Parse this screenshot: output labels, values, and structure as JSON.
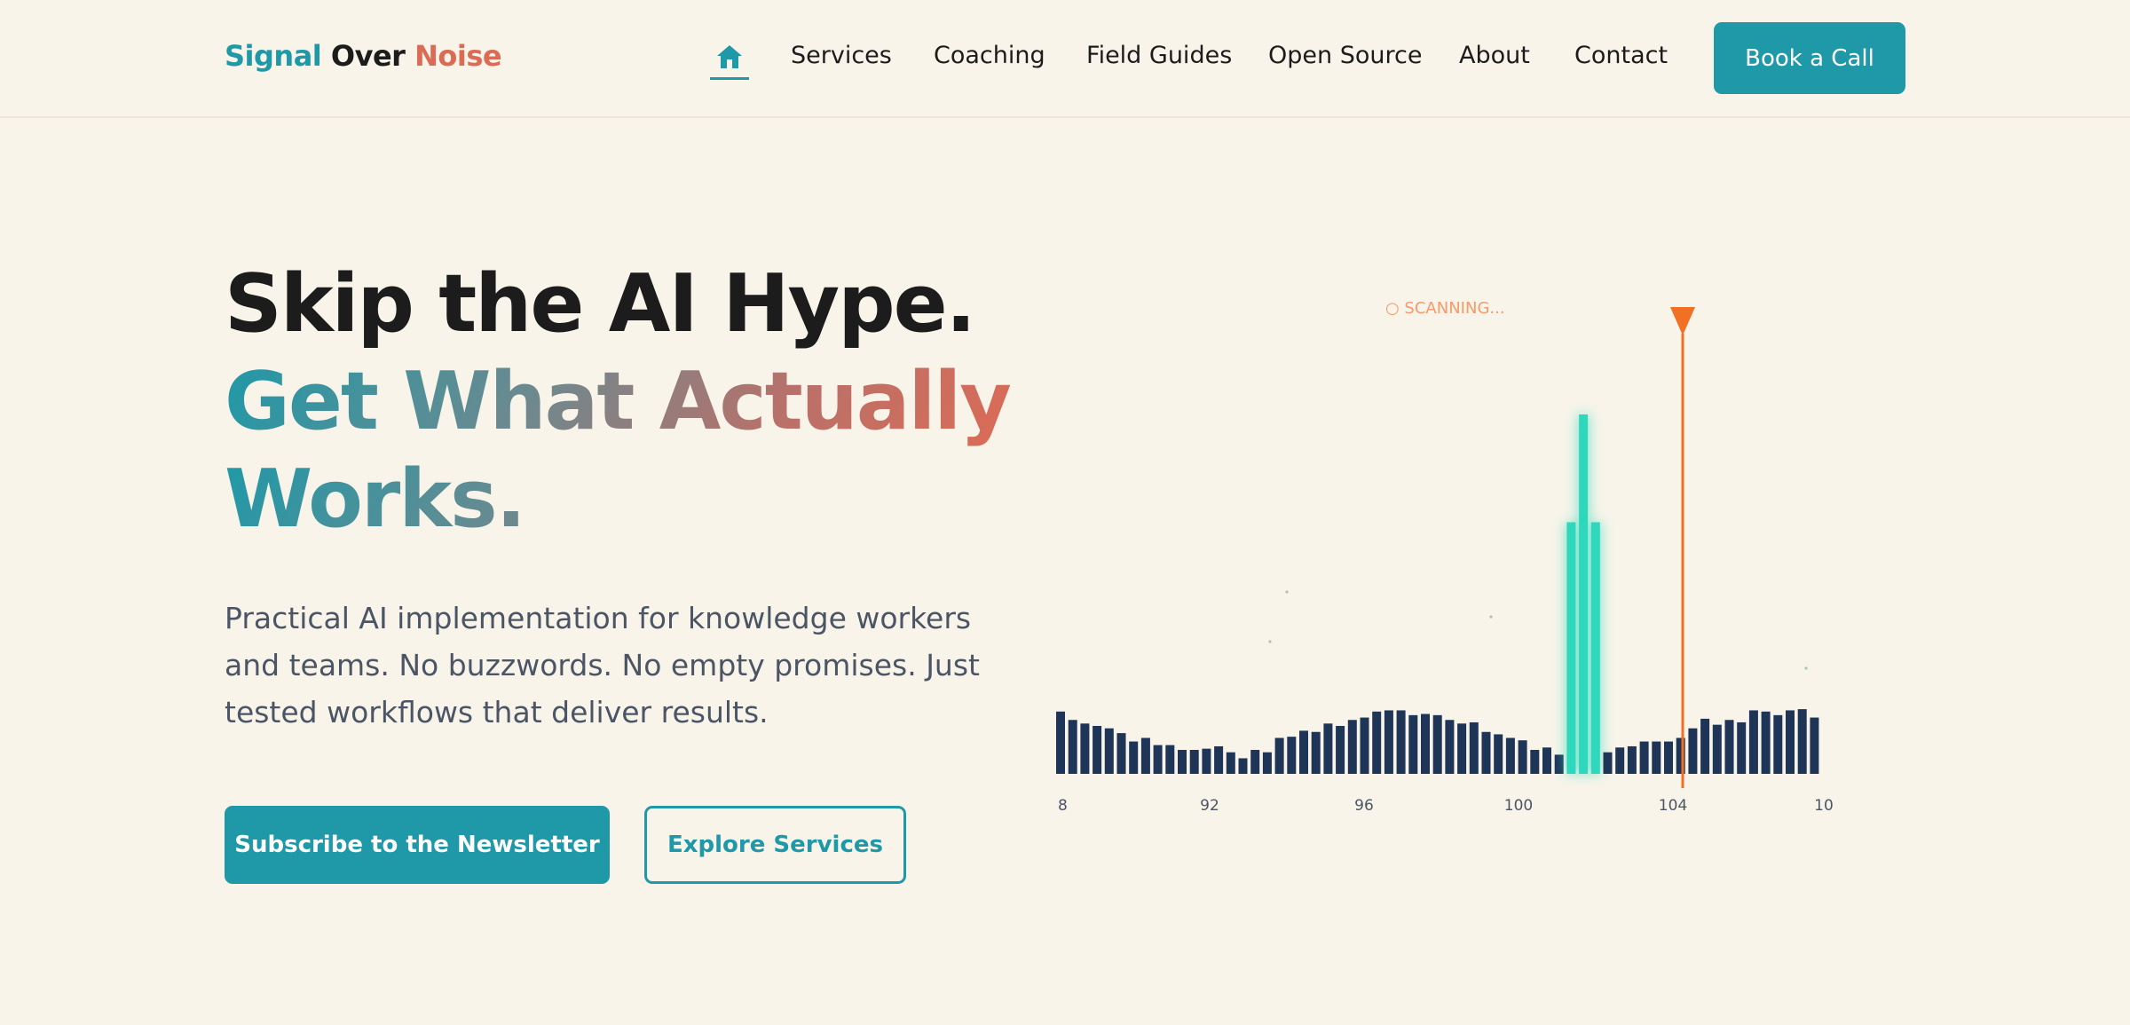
{
  "header": {
    "brand": {
      "part1": "Signal",
      "part2": "Over",
      "part3": "Noise"
    },
    "home_icon": "home-icon",
    "nav": [
      "Services",
      "Coaching",
      "Field Guides",
      "Open Source",
      "About",
      "Contact"
    ],
    "cta_label": "Book a Call"
  },
  "hero": {
    "title_line1": "Skip the AI Hype.",
    "title_line2": "Get What Actually",
    "title_line3": "Works.",
    "subtitle": "Practical AI implementation for knowledge workers and teams. No buzzwords. No empty promises. Just tested workflows that deliver results.",
    "primary_button": "Subscribe to the Newsletter",
    "secondary_button": "Explore Services"
  },
  "visual": {
    "status_label": "○ SCANNING...",
    "tick_labels": [
      "8",
      "92",
      "96",
      "100",
      "104",
      "10"
    ],
    "colors": {
      "bars": "#1f3558",
      "signal": "#2ed8bc",
      "marker": "#f27024",
      "accent": "#1f99a8",
      "coral": "#dc6b55"
    },
    "bar_levels": [
      0.52,
      0.45,
      0.42,
      0.4,
      0.38,
      0.34,
      0.27,
      0.3,
      0.24,
      0.24,
      0.2,
      0.2,
      0.21,
      0.23,
      0.18,
      0.13,
      0.2,
      0.18,
      0.3,
      0.31,
      0.36,
      0.35,
      0.42,
      0.4,
      0.45,
      0.47,
      0.52,
      0.53,
      0.53,
      0.49,
      0.5,
      0.49,
      0.45,
      0.42,
      0.43,
      0.35,
      0.33,
      0.3,
      0.28,
      0.2,
      0.22,
      0.16,
      1.0,
      1.0,
      1.0,
      0.18,
      0.22,
      0.23,
      0.27,
      0.27,
      0.27,
      0.3,
      0.38,
      0.46,
      0.41,
      0.45,
      0.43,
      0.53,
      0.52,
      0.49,
      0.53,
      0.54,
      0.47
    ],
    "signal_levels": [
      0.7,
      1.0,
      0.7
    ]
  }
}
